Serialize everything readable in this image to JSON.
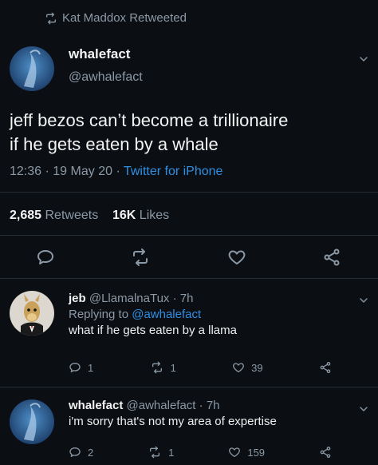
{
  "retweet_header": {
    "text": "Kat Maddox Retweeted"
  },
  "main_tweet": {
    "name": "whalefact",
    "handle": "@awhalefact",
    "text_line1": "jeff bezos can’t become a trillionaire",
    "text_line2": "if he gets eaten by a whale",
    "time": "12:36",
    "date": "19 May 20",
    "sep": "·",
    "source": "Twitter for iPhone",
    "retweets_count": "2,685",
    "retweets_label": "Retweets",
    "likes_count": "16K",
    "likes_label": "Likes"
  },
  "reply1": {
    "name": "jeb",
    "handle": "@LlamalnaTux",
    "time": "· 7h",
    "replying_prefix": "Replying to",
    "replying_handle": "@awhalefact",
    "text": "what if he gets eaten by a llama",
    "reply_count": "1",
    "retweet_count": "1",
    "like_count": "39"
  },
  "reply2": {
    "name": "whalefact",
    "handle": "@awhalefact",
    "time": "· 7h",
    "text": "i'm sorry that's not my area of expertise",
    "reply_count": "2",
    "retweet_count": "1",
    "like_count": "159"
  },
  "icons": {
    "retweet": "retweet-icon",
    "reply": "reply-icon",
    "like": "heart-icon",
    "share": "share-icon",
    "chevron": "chevron-down-icon"
  },
  "colors": {
    "background": "#0b0f14",
    "link": "#2f8fe3",
    "muted": "#8b98a5"
  }
}
